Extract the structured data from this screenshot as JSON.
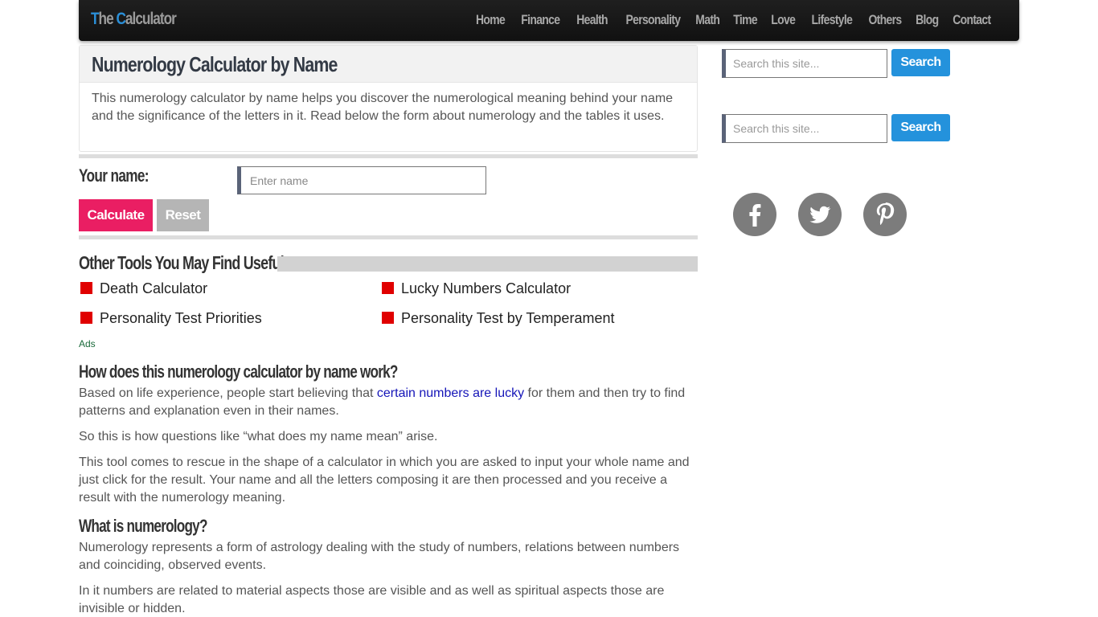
{
  "nav": {
    "brand_first": "T",
    "brand_rest1": "he ",
    "brand_second": "C",
    "brand_rest2": "alculator",
    "items": [
      "Home",
      "Finance",
      "Health",
      "Personality",
      "Math",
      "Time",
      "Love",
      "Lifestyle",
      "Others",
      "Blog",
      "Contact"
    ]
  },
  "intro": {
    "title": "Numerology Calculator by Name",
    "text": "This numerology calculator by name helps you discover the numerological meaning behind your name and the significance of the letters in it. Read below the form about numerology and the tables it uses."
  },
  "form": {
    "name_label": "Your name:",
    "name_placeholder": "Enter name",
    "name_value": "",
    "calculate_label": "Calculate",
    "reset_label": "Reset"
  },
  "tools": {
    "title": "Other Tools You May Find Useful",
    "links": [
      "Death Calculator",
      "Lucky Numbers Calculator",
      "Personality Test Priorities",
      "Personality Test by Temperament"
    ]
  },
  "ads_label": "Ads",
  "article": {
    "h1": "How does this numerology calculator by name work?",
    "p1_before": "Based on life experience, people start believing that ",
    "p1_link": "certain numbers are lucky",
    "p1_after": " for them and then try to find patterns and explanation even in their names.",
    "p2": "So this is how questions like “what does my name mean” arise.",
    "p3": "This tool comes to rescue in the shape of a calculator in which you are asked to input your whole name and just click for the result. Your name and all the letters composing it are then processed and you receive a result with the numerology meaning.",
    "h2": "What is numerology?",
    "p4": "Numerology represents a form of astrology dealing with the study of numbers, relations between numbers and coinciding, observed events.",
    "p5": "In it numbers are related to material aspects those are visible and as well as spiritual aspects those are invisible or hidden."
  },
  "sidebar": {
    "search_placeholder": "Search this site...",
    "search_label": "Search",
    "social": [
      "facebook",
      "twitter",
      "pinterest"
    ]
  },
  "colors": {
    "accent_blue": "#2492dc",
    "calculate_pink": "#ea1e63",
    "bullet_red": "#e00000",
    "link_blue": "#1515b8"
  }
}
